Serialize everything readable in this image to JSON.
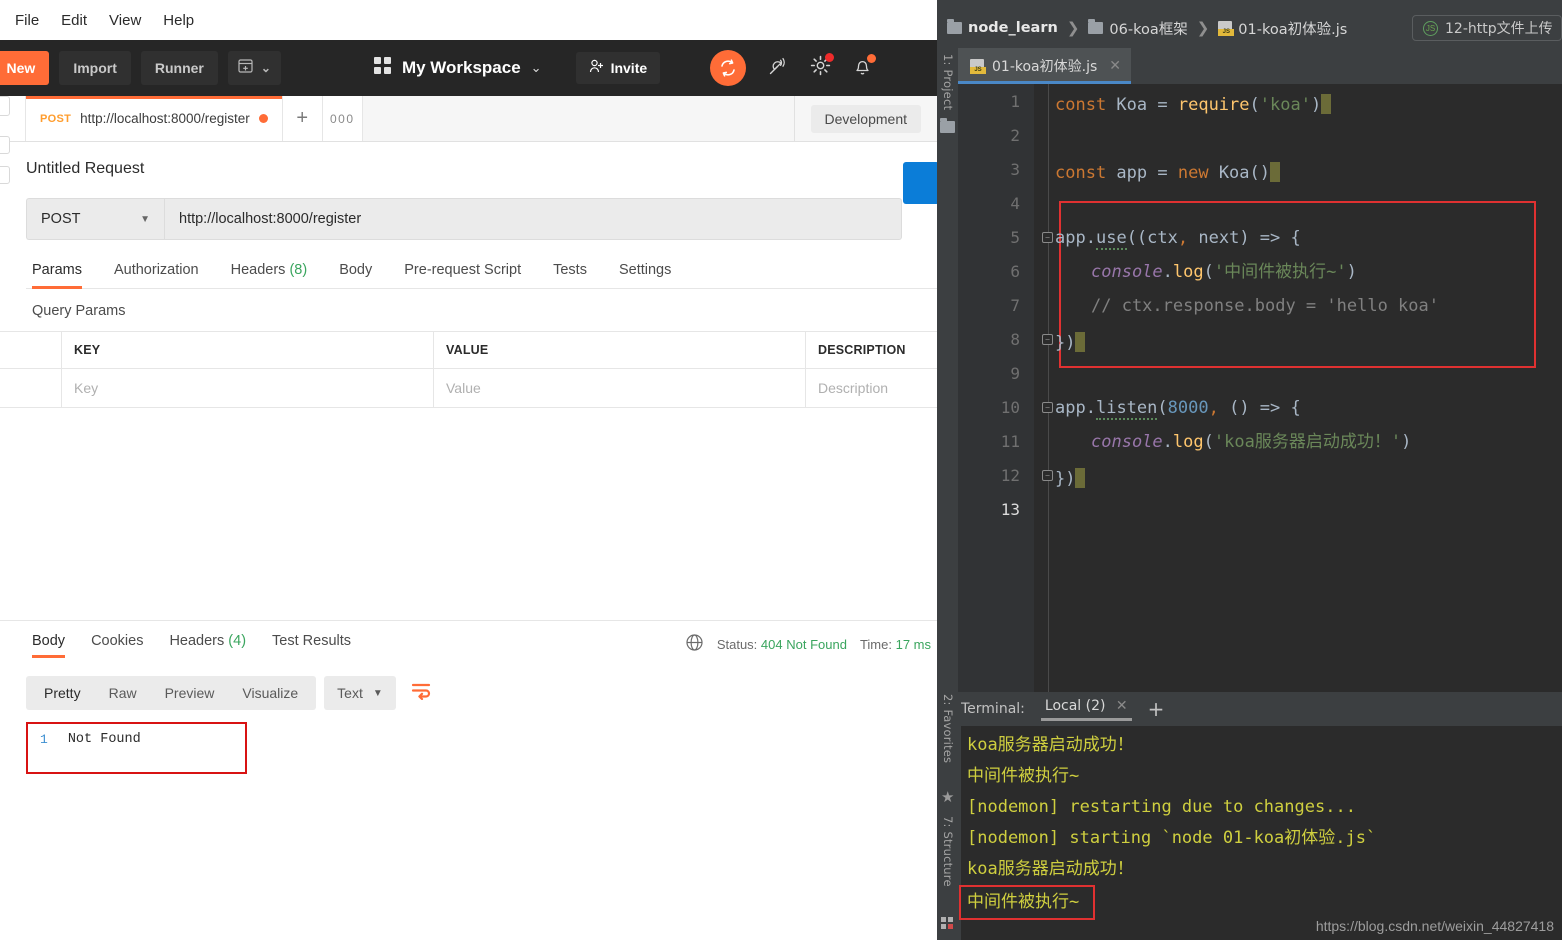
{
  "postman": {
    "menubar": [
      "File",
      "Edit",
      "View",
      "Help"
    ],
    "toolbar": {
      "new_label": "New",
      "new_plus": "+",
      "import_label": "Import",
      "runner_label": "Runner",
      "new_window_icon": "new-window-icon",
      "chevron": "⌄",
      "grid_icon": "grid-icon",
      "workspace_label": "My Workspace",
      "workspace_caret": "⌄",
      "invite_label": "Invite",
      "invite_icon": "person-add-icon",
      "sync_icon": "sync-icon",
      "satellite_icon": "satellite-icon",
      "settings_icon": "gear-icon",
      "notifications_icon": "bell-icon"
    },
    "tabs": {
      "request_tab": {
        "method": "POST",
        "url": "http://localhost:8000/register",
        "unsaved": true
      },
      "add_tab": "+",
      "more_tab": "000"
    },
    "environment": {
      "selected": "Development"
    },
    "request": {
      "title": "Untitled Request",
      "method": "POST",
      "method_caret": "▼",
      "url": "http://localhost:8000/register",
      "tabs": [
        {
          "label": "Params",
          "count": "",
          "active": true
        },
        {
          "label": "Authorization",
          "count": "",
          "active": false
        },
        {
          "label": "Headers",
          "count": "(8)",
          "active": false
        },
        {
          "label": "Body",
          "count": "",
          "active": false
        },
        {
          "label": "Pre-request Script",
          "count": "",
          "active": false
        },
        {
          "label": "Tests",
          "count": "",
          "active": false
        },
        {
          "label": "Settings",
          "count": "",
          "active": false
        }
      ],
      "query_params_label": "Query Params",
      "table": {
        "headers": [
          "KEY",
          "VALUE",
          "DESCRIPTION"
        ],
        "row_placeholders": [
          "Key",
          "Value",
          "Description"
        ]
      }
    },
    "response": {
      "tabs": [
        {
          "label": "Body",
          "count": "",
          "active": true
        },
        {
          "label": "Cookies",
          "count": "",
          "active": false
        },
        {
          "label": "Headers",
          "count": "(4)",
          "active": false
        },
        {
          "label": "Test Results",
          "count": "",
          "active": false
        }
      ],
      "globe_icon": "globe-icon",
      "status_label": "Status:",
      "status_value": "404 Not Found",
      "time_label": "Time:",
      "time_value": "17 ms",
      "view_modes": [
        "Pretty",
        "Raw",
        "Preview",
        "Visualize"
      ],
      "active_view": "Pretty",
      "format": "Text",
      "format_caret": "▼",
      "wrap_icon": "word-wrap-icon",
      "body_line_number": "1",
      "body_text": "Not Found"
    },
    "colors": {
      "accent": "#ff6c37",
      "topbar": "#262626",
      "success_green": "#3aa55e",
      "send_blue": "#0b7dd8",
      "highlight_red": "#d81313"
    }
  },
  "ide": {
    "breadcrumb": [
      {
        "icon": "folder-icon",
        "label": "node_learn",
        "bold": true
      },
      {
        "icon": "folder-icon",
        "label": "06-koa框架",
        "bold": false
      },
      {
        "icon": "js-file-icon",
        "label": "01-koa初体验.js",
        "bold": false
      }
    ],
    "breadcrumb_separator": "❯",
    "run_config": {
      "icon": "nodejs-icon",
      "label": "12-http文件上传"
    },
    "left_rail": [
      "1: Project",
      "2: Favorites",
      "7: Structure"
    ],
    "file_tabs": [
      {
        "icon": "js-file-icon",
        "label": "01-koa初体验.js",
        "close": "✕",
        "active": true
      }
    ],
    "editor": {
      "lines": [
        {
          "n": "1",
          "fold": false,
          "indent": 0,
          "tokens": [
            {
              "t": "const ",
              "c": "k"
            },
            {
              "t": "Koa",
              "c": "cls"
            },
            {
              "t": " = ",
              "c": "id"
            },
            {
              "t": "require",
              "c": "fn"
            },
            {
              "t": "(",
              "c": "par"
            },
            {
              "t": "'koa'",
              "c": "str"
            },
            {
              "t": ")",
              "c": "par"
            }
          ],
          "caret": true
        },
        {
          "n": "2",
          "fold": false,
          "indent": 0,
          "tokens": [],
          "caret": false
        },
        {
          "n": "3",
          "fold": false,
          "indent": 0,
          "tokens": [
            {
              "t": "const ",
              "c": "k"
            },
            {
              "t": "app",
              "c": "cls"
            },
            {
              "t": " = ",
              "c": "id"
            },
            {
              "t": "new ",
              "c": "k"
            },
            {
              "t": "Koa",
              "c": "cls"
            },
            {
              "t": "()",
              "c": "par"
            }
          ],
          "caret": true
        },
        {
          "n": "4",
          "fold": false,
          "indent": 0,
          "tokens": [],
          "caret": false
        },
        {
          "n": "5",
          "fold": true,
          "indent": 0,
          "tokens": [
            {
              "t": "app",
              "c": "id"
            },
            {
              "t": ".",
              "c": "par"
            },
            {
              "t": "use",
              "c": "id wavy"
            },
            {
              "t": "((",
              "c": "par"
            },
            {
              "t": "ctx",
              "c": "gray"
            },
            {
              "t": ",",
              "c": "k"
            },
            {
              "t": " next",
              "c": "gray"
            },
            {
              "t": ") => {",
              "c": "par"
            }
          ],
          "caret": false
        },
        {
          "n": "6",
          "fold": false,
          "indent": 1,
          "tokens": [
            {
              "t": "console",
              "c": "italic"
            },
            {
              "t": ".",
              "c": "par"
            },
            {
              "t": "log",
              "c": "fn"
            },
            {
              "t": "(",
              "c": "par"
            },
            {
              "t": "'中间件被执行~'",
              "c": "str"
            },
            {
              "t": ")",
              "c": "par"
            }
          ],
          "caret": false
        },
        {
          "n": "7",
          "fold": false,
          "indent": 1,
          "tokens": [
            {
              "t": "// ctx.response.body = 'hello koa'",
              "c": "cmt"
            }
          ],
          "caret": false
        },
        {
          "n": "8",
          "fold": true,
          "indent": 0,
          "tokens": [
            {
              "t": "})",
              "c": "par"
            }
          ],
          "caret": true
        },
        {
          "n": "9",
          "fold": false,
          "indent": 0,
          "tokens": [],
          "caret": false
        },
        {
          "n": "10",
          "fold": true,
          "indent": 0,
          "tokens": [
            {
              "t": "app",
              "c": "id"
            },
            {
              "t": ".",
              "c": "par"
            },
            {
              "t": "listen",
              "c": "id wavy"
            },
            {
              "t": "(",
              "c": "par"
            },
            {
              "t": "8000",
              "c": "num"
            },
            {
              "t": ",",
              "c": "k"
            },
            {
              "t": " () => {",
              "c": "par"
            }
          ],
          "caret": false
        },
        {
          "n": "11",
          "fold": false,
          "indent": 1,
          "tokens": [
            {
              "t": "console",
              "c": "italic"
            },
            {
              "t": ".",
              "c": "par"
            },
            {
              "t": "log",
              "c": "fn"
            },
            {
              "t": "(",
              "c": "par"
            },
            {
              "t": "'koa服务器启动成功！'",
              "c": "str"
            },
            {
              "t": ")",
              "c": "par"
            }
          ],
          "caret": false
        },
        {
          "n": "12",
          "fold": true,
          "indent": 0,
          "tokens": [
            {
              "t": "})",
              "c": "par"
            }
          ],
          "caret": true
        },
        {
          "n": "13",
          "fold": false,
          "indent": 0,
          "tokens": [],
          "caret": false,
          "current": true
        }
      ]
    },
    "terminal": {
      "label": "Terminal:",
      "tab": "Local (2)",
      "tab_close": "✕",
      "add": "+",
      "lines": [
        "koa服务器启动成功！",
        "中间件被执行~",
        "[nodemon] restarting due to changes...",
        "[nodemon] starting `node 01-koa初体验.js`",
        "koa服务器启动成功！",
        "中间件被执行~"
      ],
      "highlighted_line_index": 5
    },
    "watermark": "https://blog.csdn.net/weixin_44827418",
    "colors": {
      "bg": "#3c3f41",
      "editor_bg": "#2b2b2b",
      "terminal_text": "#cfcf3f",
      "highlight_red": "#e03131",
      "tab_underline": "#4a88c7"
    }
  }
}
